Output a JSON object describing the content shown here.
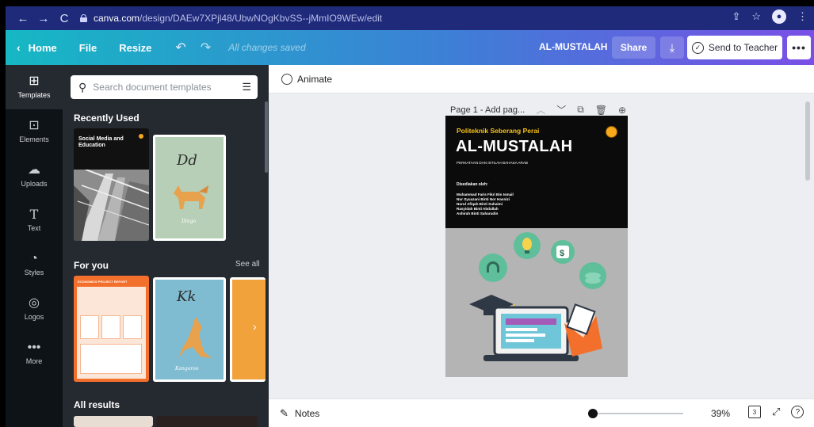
{
  "browser": {
    "url_host": "canva.com",
    "url_path": "/design/DAEw7XPjl48/UbwNOgKbvSS--jMmIO9WEw/edit"
  },
  "header": {
    "home_label": "Home",
    "file_label": "File",
    "resize_label": "Resize",
    "save_status": "All changes saved",
    "doc_title": "AL-MUSTALAH",
    "share_label": "Share",
    "send_label": "Send to Teacher",
    "more_label": "•••"
  },
  "rail": {
    "items": [
      {
        "label": "Templates",
        "icon": "templates-icon"
      },
      {
        "label": "Elements",
        "icon": "elements-icon"
      },
      {
        "label": "Uploads",
        "icon": "uploads-icon"
      },
      {
        "label": "Text",
        "icon": "text-icon"
      },
      {
        "label": "Styles",
        "icon": "styles-icon"
      },
      {
        "label": "Logos",
        "icon": "logos-icon"
      },
      {
        "label": "More",
        "icon": "more-icon"
      }
    ]
  },
  "panel": {
    "search_placeholder": "Search document templates",
    "recently_used": "Recently Used",
    "for_you": "For you",
    "see_all": "See all",
    "all_results": "All results",
    "recent_thumb_title": "Social Media and Education",
    "recent_dd_letter": "Dd",
    "recent_dd_word": "Dingo",
    "foryou_thumb_title": "ECONOMICS PROJECT REPORT",
    "foryou_kk_letter": "Kk",
    "foryou_kk_word": "Kangaroo"
  },
  "toolbar": {
    "animate_label": "Animate"
  },
  "page": {
    "label": "Page 1 - Add pag..."
  },
  "poster": {
    "institution": "Politeknik Seberang Perai",
    "title": "AL-MUSTALAH",
    "subtitle": "PERKATAAN DAN ISTILAH BAHASA ARAB",
    "prepared_by": "Disediakan oleh:",
    "names": [
      "Muhammad Faris Fikri Bin Ismail",
      "Nur Syuazani Binti Nor Hasnizi",
      "Nurul Afiqah Binti Suhaimi",
      "Rasyidah Binti Abdullah",
      "Ashirah Binti Saharudin"
    ]
  },
  "bottom": {
    "notes_label": "Notes",
    "zoom_value": "39%",
    "zoom_fraction": 0.05,
    "page_count": "3"
  },
  "colors": {
    "browser_bg": "#1f2a7a",
    "header_gradient_start": "#16b8c4",
    "header_gradient_end": "#7a4fe6",
    "rail_bg": "#0e1318",
    "panel_bg": "#252a31",
    "poster_accent": "#f7c21b"
  }
}
